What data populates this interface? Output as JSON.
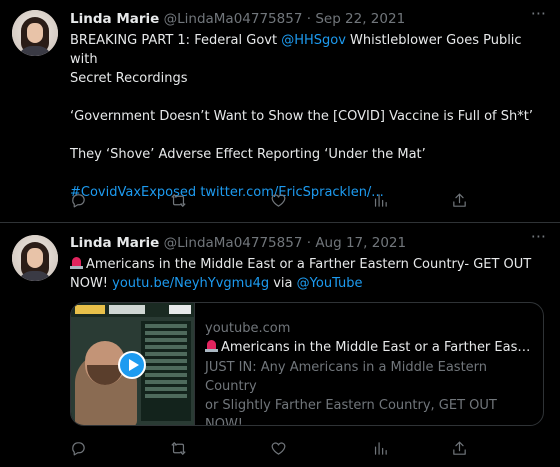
{
  "tweets": [
    {
      "name": "Linda Marie",
      "handle": "@LindaMa04775857",
      "separator": "·",
      "date": "Sep 22, 2021",
      "more": "···",
      "lines": {
        "l1_prefix": "BREAKING PART 1: Federal Govt ",
        "l1_mention": "@HHSgov",
        "l1_suffix": " Whistleblower Goes Public with",
        "l2": "Secret Recordings",
        "l3": "‘Government Doesn’t Want to Show the [COVID] Vaccine is Full of Sh*t’",
        "l4": "They ‘Shove’ Adverse Effect Reporting ‘Under the Mat’",
        "hashtag": "#CovidVaxExposed",
        "link": "twitter.com/EricSpracklen/..."
      }
    },
    {
      "name": "Linda Marie",
      "handle": "@LindaMa04775857",
      "separator": "·",
      "date": "Aug 17, 2021",
      "more": "···",
      "lines": {
        "l1": "Americans in the Middle East or a Farther Eastern Country- GET OUT",
        "l2_prefix": "NOW! ",
        "l2_link": "youtu.be/NeyhYvgmu4g",
        "l2_via": " via ",
        "l2_mention": "@YouTube"
      },
      "card": {
        "domain": "youtube.com",
        "title": "Americans in the Middle East or a Farther Easter...",
        "desc1": "JUST IN: Any Americans in a Middle Eastern Country",
        "desc2": "or Slightly Farther Eastern Country, GET OUT NOW!..."
      }
    }
  ],
  "icons": [
    "reply-icon",
    "retweet-icon",
    "like-icon",
    "analytics-icon",
    "share-icon",
    "siren-icon",
    "play-icon"
  ],
  "colors": {
    "background": "#000000",
    "text": "#e7e9ea",
    "secondary": "#71767b",
    "link": "#1d9bf0",
    "border": "#2f3336"
  }
}
